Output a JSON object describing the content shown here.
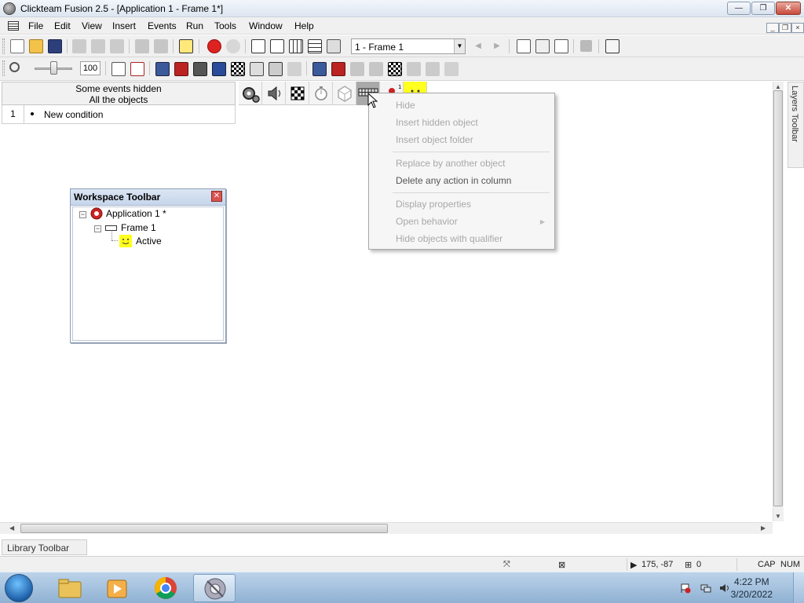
{
  "window": {
    "title": "Clickteam Fusion 2.5 - [Application 1 - Frame 1*]",
    "minimize": "—",
    "maximize": "❐",
    "close": "✕"
  },
  "menu": {
    "items": [
      "File",
      "Edit",
      "View",
      "Insert",
      "Events",
      "Run",
      "Tools",
      "Window",
      "Help"
    ]
  },
  "toolbar1": {
    "frame_select_value": "1 - Frame 1"
  },
  "toolbar2": {
    "zoom_value": "100"
  },
  "event_editor": {
    "header_line1": "Some events hidden",
    "header_line2": "All the objects",
    "rows": [
      {
        "number": "1",
        "label": "New condition"
      }
    ]
  },
  "context_menu": {
    "items": [
      {
        "label": "Hide",
        "enabled": false
      },
      {
        "label": "Insert hidden object",
        "enabled": false
      },
      {
        "label": "Insert object folder",
        "enabled": false
      },
      {
        "label": "Replace by another object",
        "enabled": false
      },
      {
        "label": "Delete any action in column",
        "enabled": true
      },
      {
        "label": "Display properties",
        "enabled": false
      },
      {
        "label": "Open behavior",
        "enabled": false,
        "submenu": true
      },
      {
        "label": "Hide objects with qualifier",
        "enabled": false
      }
    ]
  },
  "workspace": {
    "title": "Workspace Toolbar",
    "tree": {
      "application": "Application 1 *",
      "frame": "Frame 1",
      "object": "Active"
    }
  },
  "layers_toolbar": {
    "label": "Layers Toolbar"
  },
  "library_toolbar": {
    "label": "Library Toolbar"
  },
  "statusbar": {
    "coords": "175, -87",
    "objects_count": "0",
    "cap": "CAP",
    "num": "NUM"
  },
  "taskbar": {
    "time": "4:22 PM",
    "date": "3/20/2022"
  },
  "colors": {
    "accent_yellow": "#ffff20",
    "selected_column": "#a9a9a9",
    "disabled_text": "#a8a8a8"
  }
}
